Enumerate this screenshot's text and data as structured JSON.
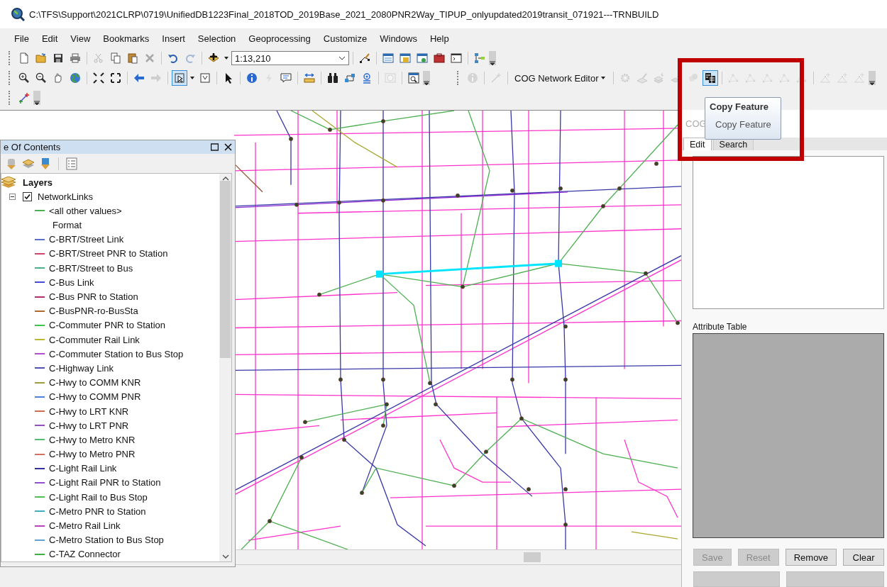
{
  "window": {
    "title": "C:\\TFS\\Support\\2021CLRP\\0719\\UnifiedDB1223Final_2018TOD_2019Base_2021_2080PNR2Way_TIPUP_onlyupdated2019transit_071921---TRNBUILD"
  },
  "menu": [
    "File",
    "Edit",
    "View",
    "Bookmarks",
    "Insert",
    "Selection",
    "Geoprocessing",
    "Customize",
    "Windows",
    "Help"
  ],
  "toolbars": [
    {
      "items": [
        {
          "kind": "tool",
          "disabled": false,
          "selected": false
        },
        {
          "kind": "tool",
          "disabled": false,
          "selected": false
        },
        {
          "kind": "tool",
          "disabled": false,
          "selected": false
        },
        {
          "kind": "tool",
          "disabled": false,
          "selected": false
        },
        {
          "kind": "tool",
          "disabled": true,
          "selected": false
        },
        {
          "kind": "tool",
          "disabled": false,
          "selected": false
        },
        {
          "kind": "tool",
          "disabled": false,
          "selected": false
        },
        {
          "kind": "tool",
          "disabled": true,
          "selected": false
        },
        {
          "kind": "tool",
          "disabled": false,
          "selected": false
        },
        {
          "kind": "tool",
          "disabled": true,
          "selected": false
        },
        {
          "kind": "tool",
          "disabled": false,
          "selected": false
        },
        {
          "kind": "combo",
          "value": "1:13,210"
        },
        {
          "kind": "tool",
          "disabled": false,
          "selected": false
        },
        {
          "kind": "tool",
          "disabled": false,
          "selected": false
        },
        {
          "kind": "tool",
          "disabled": false,
          "selected": false
        },
        {
          "kind": "tool",
          "disabled": false,
          "selected": false
        },
        {
          "kind": "tool",
          "disabled": false,
          "selected": false
        },
        {
          "kind": "tool",
          "disabled": false,
          "selected": false
        },
        {
          "kind": "tool",
          "disabled": false,
          "selected": false
        }
      ]
    },
    {
      "items": [
        {
          "kind": "tool",
          "disabled": false,
          "selected": false
        },
        {
          "kind": "tool",
          "disabled": false,
          "selected": false
        },
        {
          "kind": "tool",
          "disabled": false,
          "selected": false
        },
        {
          "kind": "tool",
          "disabled": false,
          "selected": false
        },
        {
          "kind": "tool",
          "disabled": false,
          "selected": false
        },
        {
          "kind": "tool",
          "disabled": false,
          "selected": false
        },
        {
          "kind": "tool",
          "disabled": false,
          "selected": false
        },
        {
          "kind": "tool",
          "disabled": true,
          "selected": false
        },
        {
          "kind": "tool",
          "disabled": false,
          "selected": true
        },
        {
          "kind": "tool",
          "disabled": false,
          "selected": false
        },
        {
          "kind": "tool",
          "disabled": false,
          "selected": false
        },
        {
          "kind": "tool",
          "disabled": false,
          "selected": false
        },
        {
          "kind": "tool",
          "disabled": true,
          "selected": false
        },
        {
          "kind": "tool",
          "disabled": false,
          "selected": false
        },
        {
          "kind": "tool",
          "disabled": false,
          "selected": false
        },
        {
          "kind": "tool",
          "disabled": false,
          "selected": false
        },
        {
          "kind": "tool",
          "disabled": false,
          "selected": false
        },
        {
          "kind": "tool",
          "disabled": false,
          "selected": false
        },
        {
          "kind": "tool",
          "disabled": true,
          "selected": false
        },
        {
          "kind": "tool",
          "disabled": false,
          "selected": false
        }
      ]
    },
    {
      "items": [
        {
          "kind": "tool",
          "disabled": true,
          "selected": false
        },
        {
          "kind": "tool",
          "disabled": true,
          "selected": false
        },
        {
          "kind": "menu",
          "label": "COG Network Editor"
        },
        {
          "kind": "tool",
          "disabled": true,
          "selected": false
        },
        {
          "kind": "tool",
          "disabled": true,
          "selected": false
        },
        {
          "kind": "tool",
          "disabled": true,
          "selected": false
        },
        {
          "kind": "tool",
          "disabled": true,
          "selected": false
        },
        {
          "kind": "tool",
          "disabled": true,
          "selected": false
        },
        {
          "kind": "tool",
          "disabled": false,
          "selected": true
        },
        {
          "kind": "tool",
          "disabled": true,
          "selected": false
        },
        {
          "kind": "tool",
          "disabled": true,
          "selected": false
        },
        {
          "kind": "tool",
          "disabled": true,
          "selected": false
        },
        {
          "kind": "tool",
          "disabled": true,
          "selected": false
        },
        {
          "kind": "tool",
          "disabled": true,
          "selected": false
        },
        {
          "kind": "tool",
          "disabled": true,
          "selected": false
        },
        {
          "kind": "tool",
          "disabled": true,
          "selected": false
        },
        {
          "kind": "tool",
          "disabled": true,
          "selected": false
        }
      ]
    },
    {
      "items": [
        {
          "kind": "tool",
          "disabled": false,
          "selected": false
        }
      ]
    }
  ],
  "table_of_contents": {
    "title": "e Of Contents",
    "layers": {
      "label": "Layers",
      "children": [
        {
          "label": "NetworkLinks",
          "checked": true,
          "expanded": true,
          "children": [
            {
              "label": "<all other values>",
              "color": "#4caf50"
            },
            {
              "label": "Format"
            },
            {
              "label": "C-BRT/Street Link",
              "color": "#5b6ed6"
            },
            {
              "label": "C-BRT/Street PNR to Station",
              "color": "#d0446e"
            },
            {
              "label": "C-BRT/Street to Bus",
              "color": "#4cb08a"
            },
            {
              "label": "C-Bus Link",
              "color": "#4a4ad8"
            },
            {
              "label": "C-Bus PNR to Station",
              "color": "#b0306e"
            },
            {
              "label": "C-BusPNR-ro-BusSta",
              "color": "#b06a30"
            },
            {
              "label": "C-Commuter PNR to Station",
              "color": "#3ec44a"
            },
            {
              "label": "C-Commuter Rail Link",
              "color": "#b8b830"
            },
            {
              "label": "C-Commuter Station to Bus Stop",
              "color": "#b050d0"
            },
            {
              "label": "C-Highway Link",
              "color": "#5050b0"
            },
            {
              "label": "C-Hwy to COMM KNR",
              "color": "#a09a40"
            },
            {
              "label": "C-Hwy to COMM PNR",
              "color": "#5080d8"
            },
            {
              "label": "C-Hwy to LRT KNR",
              "color": "#d07050"
            },
            {
              "label": "C-Hwy to LRT PNR",
              "color": "#9050c0"
            },
            {
              "label": "C-Hwy to Metro KNR",
              "color": "#50c070"
            },
            {
              "label": "C-Hwy to Metro PNR",
              "color": "#d07060"
            },
            {
              "label": "C-Light Rail Link",
              "color": "#3030a0"
            },
            {
              "label": "C-Light Rail PNR to Station",
              "color": "#9050d0"
            },
            {
              "label": "C-Light Rail to Bus Stop",
              "color": "#50c050"
            },
            {
              "label": "C-Metro PNR to Station",
              "color": "#40b0c0"
            },
            {
              "label": "C-Metro Rail Link",
              "color": "#c040c0"
            },
            {
              "label": "C-Metro Station to Bus Stop",
              "color": "#60a0d0"
            },
            {
              "label": "C-TAZ Connector",
              "color": "#40b040"
            }
          ]
        }
      ]
    }
  },
  "editor_panel": {
    "title": "COG",
    "tabs": [
      {
        "label": "Edit",
        "selected": true
      },
      {
        "label": "Search",
        "selected": false
      }
    ],
    "attribute_table_label": "Attribute Table",
    "buttons": [
      {
        "label": "Save",
        "disabled": true
      },
      {
        "label": "Reset",
        "disabled": true
      },
      {
        "label": "Remove",
        "disabled": false
      },
      {
        "label": "Clear",
        "disabled": false
      }
    ],
    "lower_buttons": [
      {
        "disabled": true
      },
      {
        "disabled": true
      }
    ]
  },
  "tooltip": {
    "title": "Copy Feature",
    "text": "Copy Feature"
  }
}
